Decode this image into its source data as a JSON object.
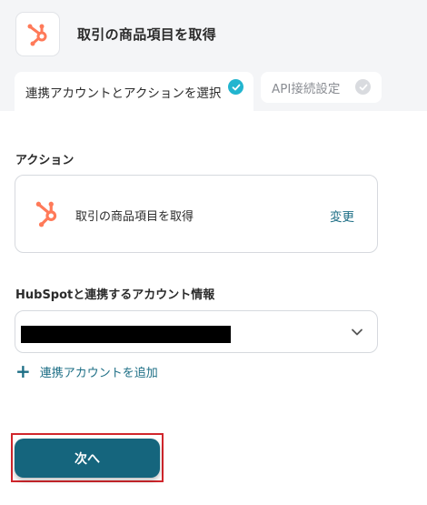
{
  "header": {
    "title": "取引の商品項目を取得",
    "app_icon": "hubspot-icon",
    "brand_color": "#ff7a59"
  },
  "tabs": [
    {
      "label": "連携アカウントとアクションを選択",
      "active": true,
      "completed": true
    },
    {
      "label": "API接続設定",
      "active": false,
      "completed": false
    }
  ],
  "action_section": {
    "label": "アクション",
    "action_name": "取引の商品項目を取得",
    "change_label": "変更"
  },
  "account_section": {
    "label": "HubSpotと連携するアカウント情報",
    "selected_value_redacted": true,
    "add_label": "連携アカウントを追加"
  },
  "next_button": {
    "label": "次へ",
    "color": "#15657d",
    "highlight_color": "#d1262c"
  },
  "colors": {
    "accent": "#1e6f86",
    "check_active": "#22b5cf",
    "check_inactive": "#d9dbdf"
  }
}
